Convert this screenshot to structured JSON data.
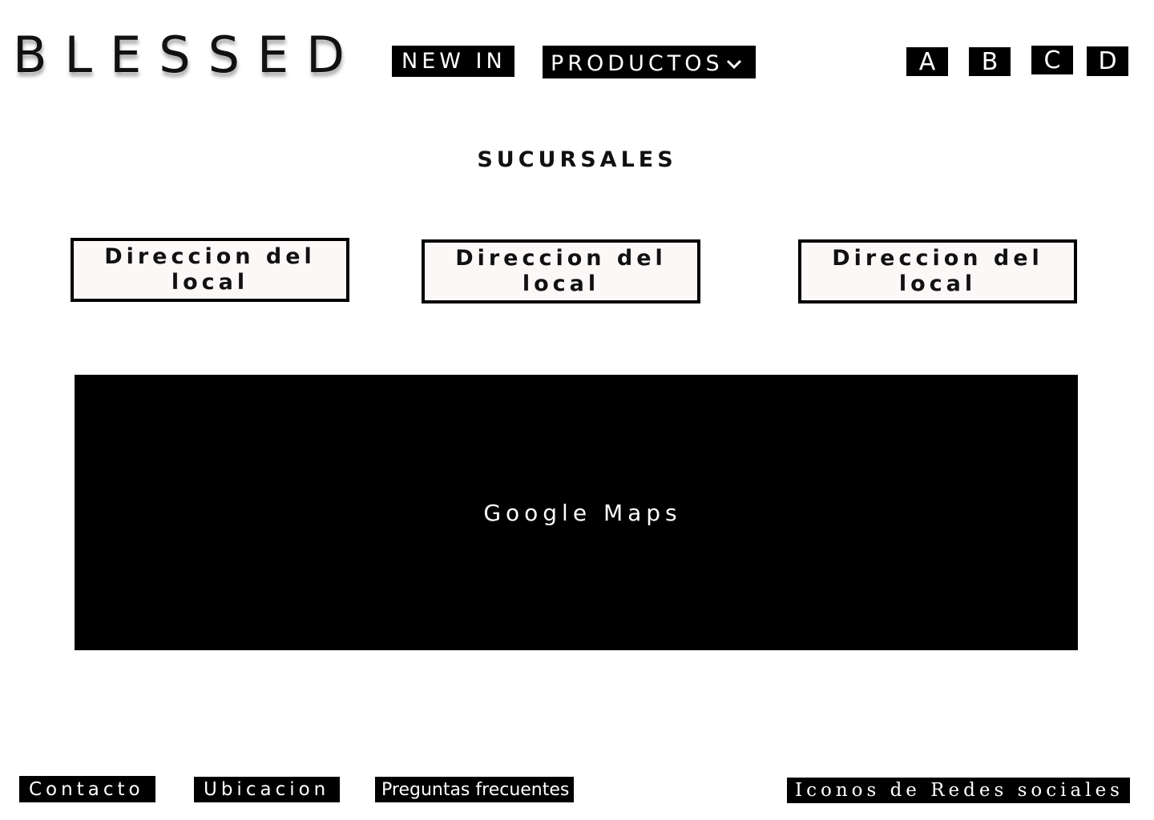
{
  "header": {
    "logo": "BLESSED",
    "nav": {
      "new_in": "NEW IN",
      "productos": "PRODUCTOS"
    },
    "icons": [
      "A",
      "B",
      "C",
      "D"
    ]
  },
  "main": {
    "title": "SUCURSALES",
    "addresses": [
      "Direccion del local",
      "Direccion del local",
      "Direccion del local"
    ],
    "map_placeholder": "Google Maps"
  },
  "footer": {
    "contacto": "Contacto",
    "ubicacion": "Ubicacion",
    "faq": "Preguntas frecuentes",
    "social": "Iconos de Redes sociales"
  }
}
